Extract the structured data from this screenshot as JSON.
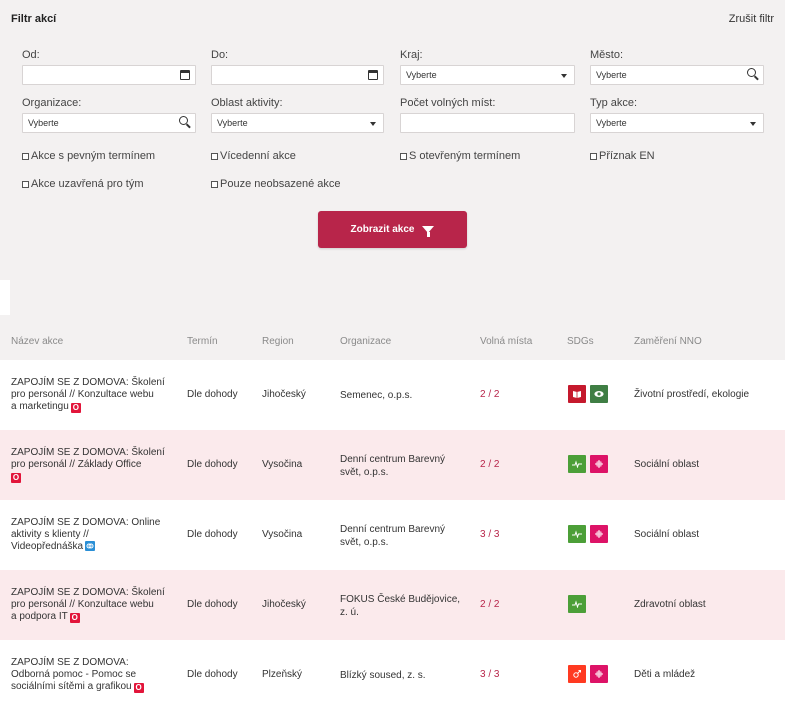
{
  "filter": {
    "title": "Filtr akcí",
    "clear_label": "Zrušit filtr",
    "fields": {
      "from": {
        "label": "Od:",
        "value": ""
      },
      "to": {
        "label": "Do:",
        "value": ""
      },
      "region": {
        "label": "Kraj:",
        "value": "Vyberte"
      },
      "city": {
        "label": "Město:",
        "value": "Vyberte"
      },
      "organization": {
        "label": "Organizace:",
        "value": "Vyberte"
      },
      "activity_area": {
        "label": "Oblast aktivity:",
        "value": "Vyberte"
      },
      "free_places": {
        "label": "Počet volných míst:",
        "value": ""
      },
      "event_type": {
        "label": "Typ akce:",
        "value": "Vyberte"
      }
    },
    "checkboxes": [
      "Akce s pevným termínem",
      "Vícedenní akce",
      "S otevřeným termínem",
      "Příznak EN",
      "Akce uzavřená pro tým",
      "Pouze neobsazené akce"
    ],
    "submit_label": "Zobrazit akce"
  },
  "table": {
    "headers": [
      "Název akce",
      "Termín",
      "Region",
      "Organizace",
      "Volná místa",
      "SDGs",
      "Zaměření NNO"
    ],
    "rows": [
      {
        "name_lines": [
          "ZAPOJÍM SE Z DOMOVA: Školení",
          "pro personál // Konzultace webu",
          "a marketingu"
        ],
        "badge": "O",
        "badge_color": "#e2153a",
        "term": "Dle dohody",
        "region": "Jihočeský",
        "org_lines": [
          "Semenec, o.p.s."
        ],
        "slots": "2 / 2",
        "sdgs": [
          {
            "color": "#c5192d",
            "icon": "book-icon"
          },
          {
            "color": "#3f7e44",
            "icon": "eye-icon"
          }
        ],
        "focus": "Životní prostředí, ekologie"
      },
      {
        "name_lines": [
          "ZAPOJÍM SE Z DOMOVA: Školení",
          "pro personál // Základy Office"
        ],
        "badge": "O",
        "badge_color": "#e2153a",
        "term": "Dle dohody",
        "region": "Vysočina",
        "org_lines": [
          "Denní centrum Barevný",
          "svět, o.p.s."
        ],
        "slots": "2 / 2",
        "sdgs": [
          {
            "color": "#4c9f38",
            "icon": "heartbeat-icon"
          },
          {
            "color": "#dd1367",
            "icon": "equality-icon"
          }
        ],
        "focus": "Sociální oblast"
      },
      {
        "name_lines": [
          "ZAPOJÍM SE Z DOMOVA: Online",
          "aktivity s klienty //",
          "Videopřednáška"
        ],
        "badge": "",
        "badge_color": "#2a8fd6",
        "term": "Dle dohody",
        "region": "Vysočina",
        "org_lines": [
          "Denní centrum Barevný",
          "svět, o.p.s."
        ],
        "slots": "3 / 3",
        "sdgs": [
          {
            "color": "#4c9f38",
            "icon": "heartbeat-icon"
          },
          {
            "color": "#dd1367",
            "icon": "equality-icon"
          }
        ],
        "focus": "Sociální oblast"
      },
      {
        "name_lines": [
          "ZAPOJÍM SE Z DOMOVA: Školení",
          "pro personál // Konzultace webu",
          "a podpora IT"
        ],
        "badge": "O",
        "badge_color": "#e2153a",
        "term": "Dle dohody",
        "region": "Jihočeský",
        "org_lines": [
          "FOKUS České Budějovice,",
          "z. ú."
        ],
        "slots": "2 / 2",
        "sdgs": [
          {
            "color": "#4c9f38",
            "icon": "heartbeat-icon"
          }
        ],
        "focus": "Zdravotní oblast"
      },
      {
        "name_lines": [
          "ZAPOJÍM SE Z DOMOVA:",
          "Odborná pomoc - Pomoc se",
          "sociálními sítěmi a grafikou"
        ],
        "badge": "O",
        "badge_color": "#e2153a",
        "term": "Dle dohody",
        "region": "Plzeňský",
        "org_lines": [
          "Blízký soused, z. s."
        ],
        "slots": "3 / 3",
        "sdgs": [
          {
            "color": "#ff3a21",
            "icon": "gender-icon"
          },
          {
            "color": "#dd1367",
            "icon": "equality-icon"
          }
        ],
        "focus": "Děti a mládež"
      }
    ]
  }
}
